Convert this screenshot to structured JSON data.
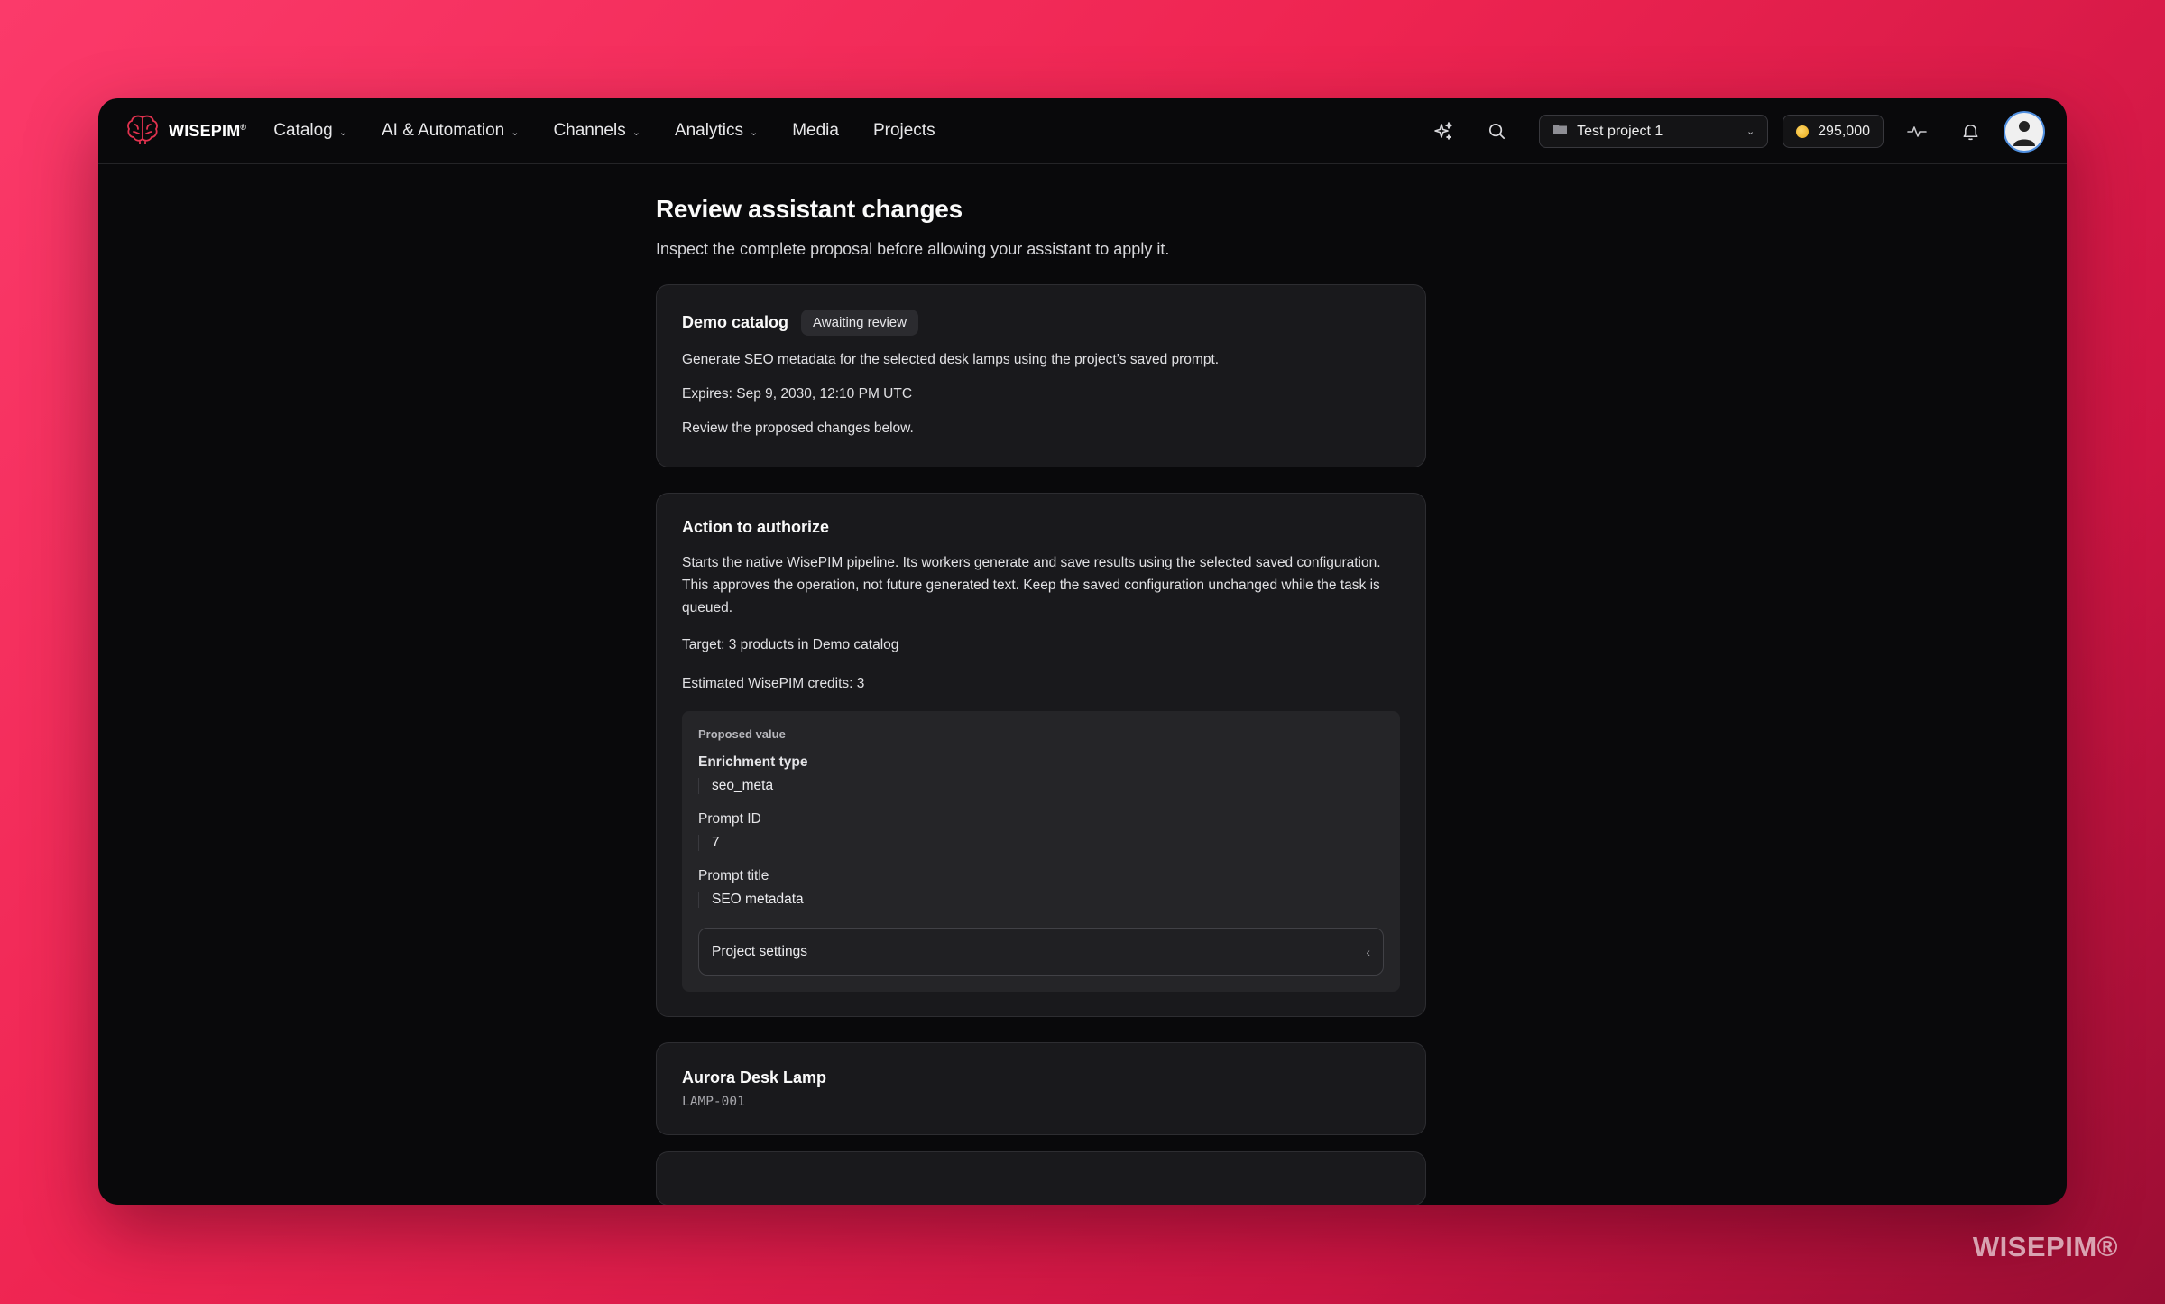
{
  "brand": {
    "name": "WISEPIM",
    "mark": "®",
    "watermark": "WISEPIM®"
  },
  "nav": {
    "items": [
      {
        "label": "Catalog",
        "dropdown": true
      },
      {
        "label": "AI & Automation",
        "dropdown": true
      },
      {
        "label": "Channels",
        "dropdown": true
      },
      {
        "label": "Analytics",
        "dropdown": true
      },
      {
        "label": "Media",
        "dropdown": false
      },
      {
        "label": "Projects",
        "dropdown": false
      }
    ],
    "icons": [
      "sparkles-icon",
      "search-icon",
      "activity-icon",
      "bell-icon",
      "user-icon"
    ],
    "project": {
      "label": "Test project 1",
      "icon": "folder-icon"
    },
    "credits": {
      "value": "295,000",
      "icon": "coin-icon"
    }
  },
  "page": {
    "title": "Review assistant changes",
    "subtitle": "Inspect the complete proposal before allowing your assistant to apply it."
  },
  "summary_card": {
    "title": "Demo catalog",
    "badge": "Awaiting review",
    "description": "Generate SEO metadata for the selected desk lamps using the project’s saved prompt.",
    "expires": "Expires: Sep 9, 2030, 12:10 PM UTC",
    "note": "Review the proposed changes below."
  },
  "action_card": {
    "title": "Action to authorize",
    "description": "Starts the native WisePIM pipeline. Its workers generate and save results using the selected saved configuration. This approves the operation, not future generated text. Keep the saved configuration unchanged while the task is queued.",
    "target": "Target: 3 products in Demo catalog",
    "credits": "Estimated WisePIM credits: 3",
    "proposal": {
      "label": "Proposed value",
      "fields": [
        {
          "label": "Enrichment type",
          "value": "seo_meta"
        },
        {
          "label": "Prompt ID",
          "value": "7"
        },
        {
          "label": "Prompt title",
          "value": "SEO metadata"
        }
      ],
      "settings_label": "Project settings"
    }
  },
  "products": [
    {
      "name": "Aurora Desk Lamp",
      "sku": "LAMP-001"
    }
  ],
  "colors": {
    "background_gradient": [
      "#fb3a6a",
      "#ee2451",
      "#cd1543",
      "#9a0d33"
    ],
    "window": "#09090b",
    "card": "#19191c",
    "avatar_ring": "#4f8fe0",
    "logo": "#e2324f"
  }
}
